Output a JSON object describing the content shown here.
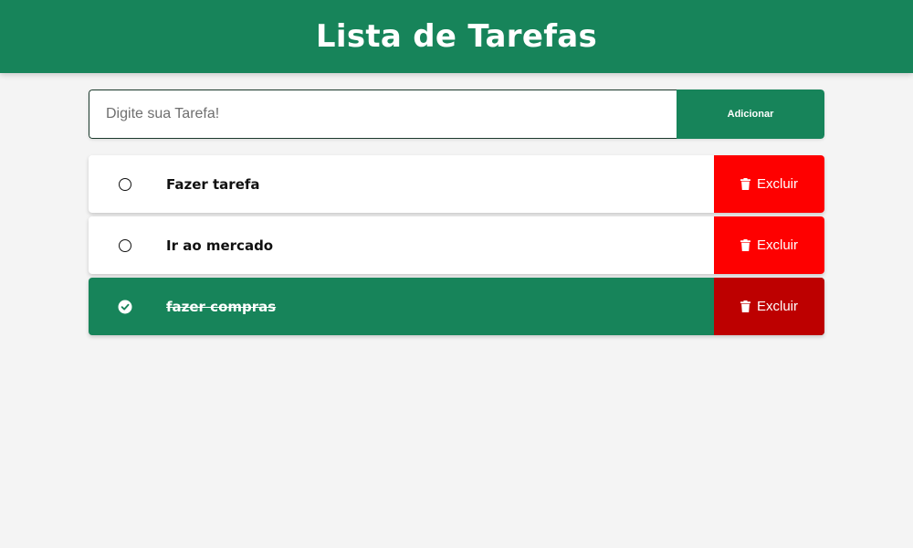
{
  "header": {
    "title": "Lista de Tarefas"
  },
  "form": {
    "input_value": "",
    "input_placeholder": "Digite sua Tarefa!",
    "add_label": "Adicionar"
  },
  "tasks": [
    {
      "text": "Fazer tarefa",
      "completed": false,
      "delete_label": "Excluir",
      "check_icon": "empty-circle-icon",
      "delete_icon": "trash-icon"
    },
    {
      "text": "Ir ao mercado",
      "completed": false,
      "delete_label": "Excluir",
      "check_icon": "empty-circle-icon",
      "delete_icon": "trash-icon"
    },
    {
      "text": "fazer compras",
      "completed": true,
      "delete_label": "Excluir",
      "check_icon": "check-circle-icon",
      "delete_icon": "trash-icon"
    }
  ],
  "colors": {
    "primary": "#17845a",
    "background": "#f4f4f4",
    "delete": "#fe0000",
    "delete_done": "#bd0000"
  }
}
